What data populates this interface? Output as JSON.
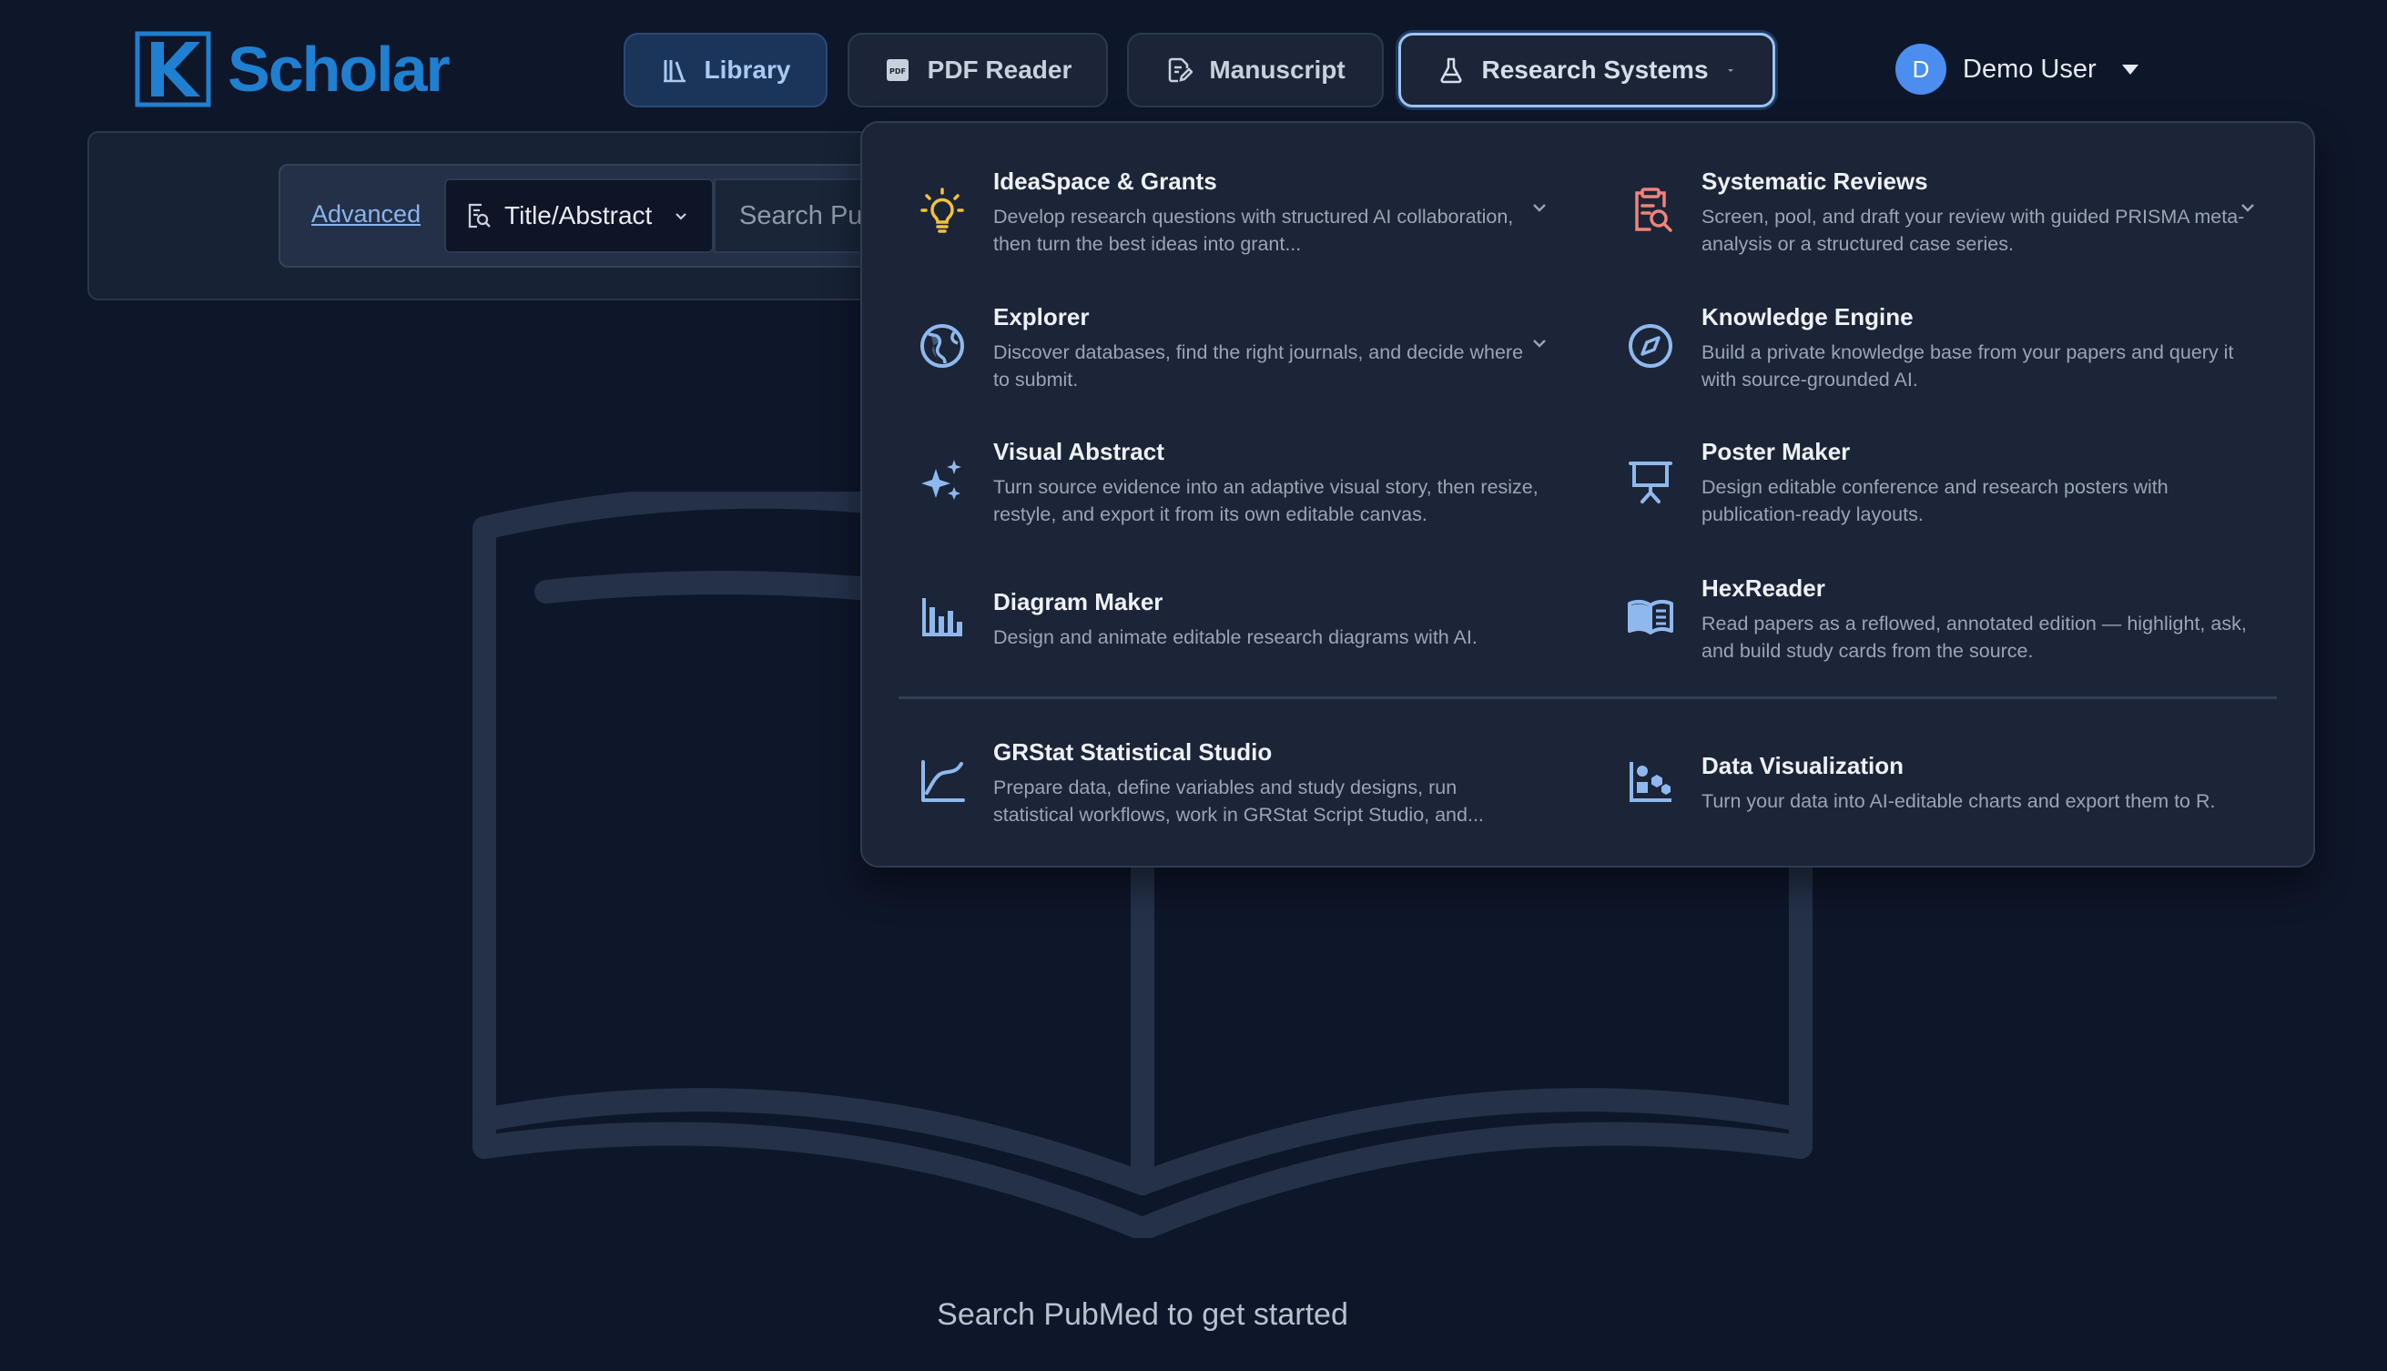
{
  "app": {
    "name": "Scholar",
    "logo_letter": "K"
  },
  "nav": {
    "library": "Library",
    "pdf_reader": "PDF Reader",
    "pdf_badge": "PDF",
    "manuscript": "Manuscript",
    "research_systems": "Research Systems"
  },
  "user": {
    "initial": "D",
    "name": "Demo User"
  },
  "search": {
    "advanced_label": "Advanced",
    "field_selected": "Title/Abstract",
    "placeholder": "Search PubMed..."
  },
  "empty_state": {
    "message": "Search PubMed to get started"
  },
  "menu": {
    "items": [
      {
        "title": "IdeaSpace & Grants",
        "desc": "Develop research questions with structured AI collaboration, then turn the best ideas into grant...",
        "icon": "lightbulb-icon",
        "expandable": true
      },
      {
        "title": "Systematic Reviews",
        "desc": "Screen, pool, and draft your review with guided PRISMA meta-analysis or a structured case series.",
        "icon": "clipboard-search-icon",
        "expandable": true
      },
      {
        "title": "Explorer",
        "desc": "Discover databases, find the right journals, and decide where to submit.",
        "icon": "globe-icon",
        "expandable": true
      },
      {
        "title": "Knowledge Engine",
        "desc": "Build a private knowledge base from your papers and query it with source-grounded AI.",
        "icon": "compass-icon",
        "expandable": false
      },
      {
        "title": "Visual Abstract",
        "desc": "Turn source evidence into an adaptive visual story, then resize, restyle, and export it from its own editable canvas.",
        "icon": "sparkles-icon",
        "expandable": false
      },
      {
        "title": "Poster Maker",
        "desc": "Design editable conference and research posters with publication-ready layouts.",
        "icon": "presentation-icon",
        "expandable": false
      },
      {
        "title": "Diagram Maker",
        "desc": "Design and animate editable research diagrams with AI.",
        "icon": "bar-chart-icon",
        "expandable": false
      },
      {
        "title": "HexReader",
        "desc": "Read papers as a reflowed, annotated edition — highlight, ask, and build study cards from the source.",
        "icon": "open-book-icon",
        "expandable": false
      },
      {
        "title": "GRStat Statistical Studio",
        "desc": "Prepare data, define variables and study designs, run statistical workflows, work in GRStat Script Studio, and...",
        "icon": "line-chart-icon",
        "expandable": false
      },
      {
        "title": "Data Visualization",
        "desc": "Turn your data into AI-editable charts and export them to R.",
        "icon": "shapes-icon",
        "expandable": false
      }
    ]
  },
  "colors": {
    "background": "#0e1629",
    "accent": "#1f7fd1",
    "lightbulb": "#f2c23a",
    "reviews": "#f0837b",
    "icon_blue": "#8fb9ee"
  }
}
